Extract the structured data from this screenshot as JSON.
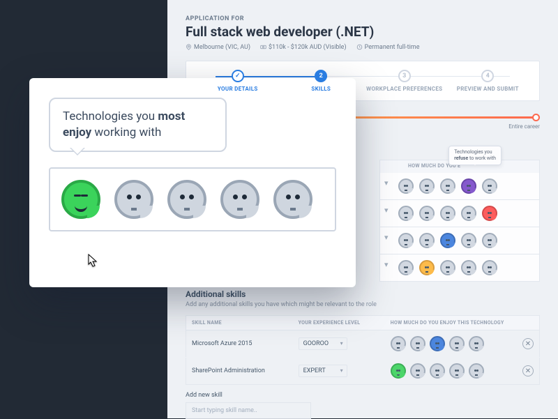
{
  "header": {
    "app_for_label": "APPLICATION FOR",
    "title": "Full stack web developer (.NET)",
    "location": "Melbourne (VIC, AU)",
    "salary": "$110k - $120k AUD (Visible)",
    "type": "Permanent full-time"
  },
  "stepper": {
    "steps": [
      {
        "label": "YOUR DETAILS",
        "state": "done",
        "mark": "✓"
      },
      {
        "label": "SKILLS",
        "state": "active",
        "mark": "2"
      },
      {
        "label": "WORKPLACE PREFERENCES",
        "state": "future",
        "mark": "3"
      },
      {
        "label": "PREVIEW AND SUBMIT",
        "state": "future",
        "mark": "4"
      }
    ]
  },
  "slider": {
    "max_label": "Entire career"
  },
  "enjoy_header": "HOW MUCH DO YOU E",
  "tooltip_refuse": {
    "line1": "Technologies you",
    "line2_strong": "refuse",
    "line2_rest": " to work with"
  },
  "additional": {
    "title": "Additional skills",
    "subtitle": "Add any additional skills you have which might be relevant to the role",
    "cols": {
      "name": "SKILL NAME",
      "level": "YOUR EXPERIENCE LEVEL",
      "enjoy": "HOW MUCH DO YOU ENJOY THIS TECHNOLOGY"
    },
    "rows": [
      {
        "name": "Microsoft Azure 2015",
        "level": "GOOROO",
        "faces": [
          "grey",
          "grey",
          "blue",
          "grey",
          "grey"
        ]
      },
      {
        "name": "SharePoint Administration",
        "level": "EXPERT",
        "faces": [
          "green",
          "grey",
          "grey",
          "grey",
          "grey"
        ]
      }
    ],
    "add_label": "Add new skill",
    "add_placeholder": "Start typing skill name.."
  },
  "popover": {
    "speech_pre": "Technologies you ",
    "speech_strong": "most enjoy",
    "speech_post": " working with"
  },
  "upper_rows_faces": [
    [
      "grey",
      "grey",
      "grey",
      "purple",
      "grey"
    ],
    [
      "grey",
      "grey",
      "grey",
      "grey",
      "red"
    ],
    [
      "grey",
      "grey",
      "blue",
      "grey",
      "grey"
    ],
    [
      "grey",
      "orange",
      "grey",
      "grey",
      "grey"
    ]
  ]
}
